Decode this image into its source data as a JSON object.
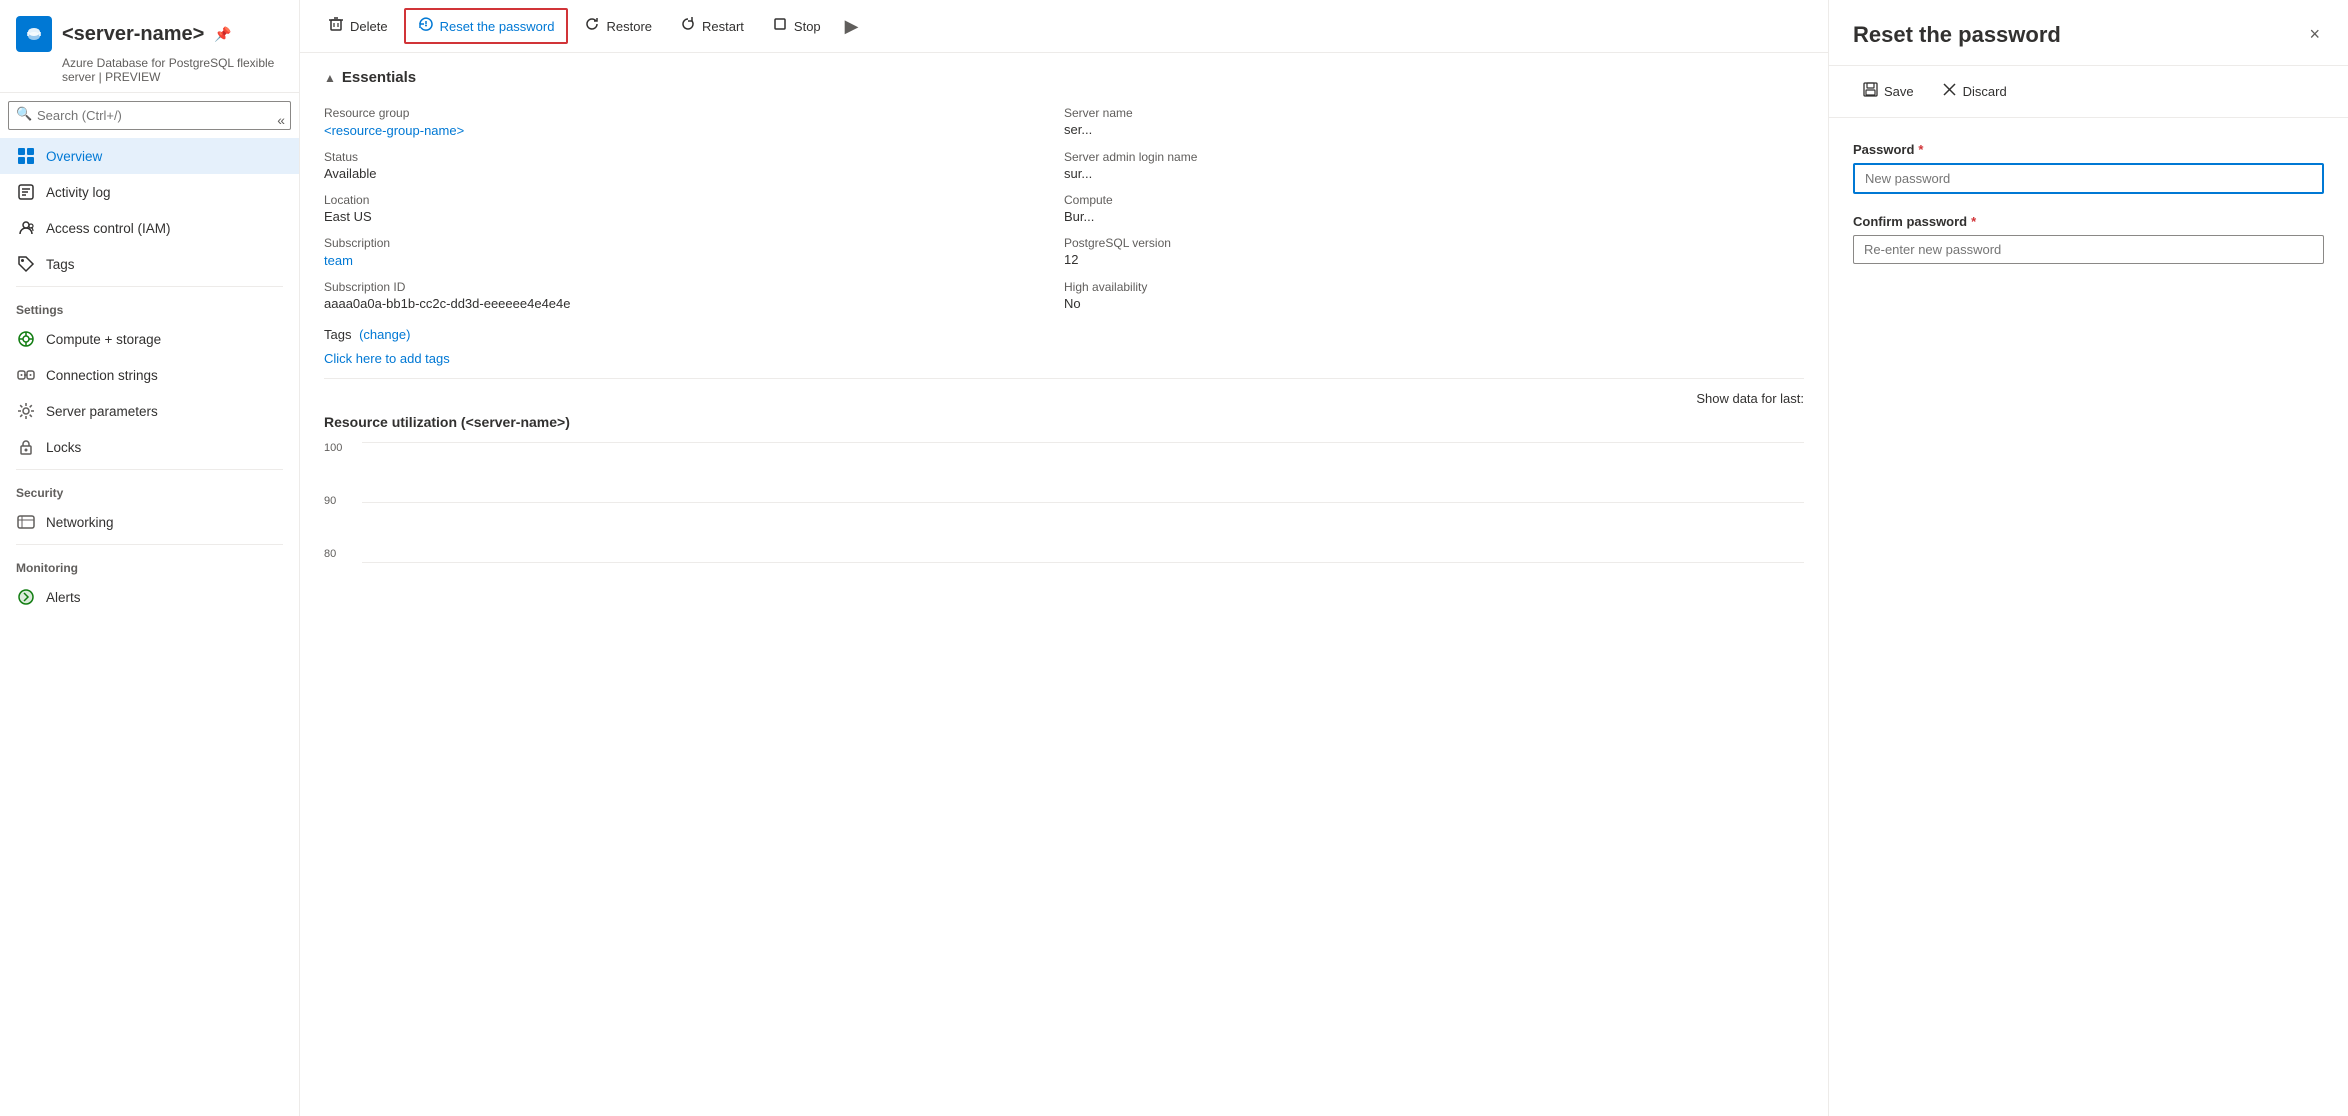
{
  "sidebar": {
    "server_name": "<server-name>",
    "server_subtitle": "Azure Database for PostgreSQL flexible server | PREVIEW",
    "search_placeholder": "Search (Ctrl+/)",
    "collapse_label": "«",
    "nav_items": [
      {
        "id": "overview",
        "label": "Overview",
        "icon": "🔵",
        "active": true
      },
      {
        "id": "activity-log",
        "label": "Activity log",
        "icon": "📋",
        "active": false
      },
      {
        "id": "access-control",
        "label": "Access control (IAM)",
        "icon": "👥",
        "active": false
      },
      {
        "id": "tags",
        "label": "Tags",
        "icon": "🏷",
        "active": false
      }
    ],
    "settings_section": "Settings",
    "settings_items": [
      {
        "id": "compute-storage",
        "label": "Compute + storage",
        "icon": "⚙"
      },
      {
        "id": "connection-strings",
        "label": "Connection strings",
        "icon": "🔗"
      },
      {
        "id": "server-parameters",
        "label": "Server parameters",
        "icon": "⚙"
      },
      {
        "id": "locks",
        "label": "Locks",
        "icon": "🔒"
      }
    ],
    "security_section": "Security",
    "security_items": [
      {
        "id": "networking",
        "label": "Networking",
        "icon": "🌐"
      }
    ],
    "monitoring_section": "Monitoring",
    "monitoring_items": [
      {
        "id": "alerts",
        "label": "Alerts",
        "icon": "🟢"
      }
    ]
  },
  "toolbar": {
    "delete_label": "Delete",
    "reset_password_label": "Reset the password",
    "restore_label": "Restore",
    "restart_label": "Restart",
    "stop_label": "Stop"
  },
  "essentials": {
    "header": "Essentials",
    "items": [
      {
        "label": "Resource group",
        "value": "<resource-group-name>",
        "is_link": true
      },
      {
        "label": "Server name",
        "value": "ser...",
        "is_link": false
      },
      {
        "label": "Status",
        "value": "Available",
        "is_link": false
      },
      {
        "label": "Server admin login name",
        "value": "sur...",
        "is_link": false
      },
      {
        "label": "Location",
        "value": "East US",
        "is_link": false
      },
      {
        "label": "Compute",
        "value": "Bur...",
        "is_link": false
      },
      {
        "label": "Subscription",
        "value": "team",
        "is_link": true
      },
      {
        "label": "PostgreSQL version",
        "value": "12",
        "is_link": false
      },
      {
        "label": "Subscription ID",
        "value": "aaaa0a0a-bb1b-cc2c-dd3d-eeeeee4e4e4e",
        "is_link": false
      },
      {
        "label": "High availability",
        "value": "No",
        "is_link": false
      }
    ]
  },
  "tags": {
    "label": "Tags",
    "change_link": "(change)",
    "add_link": "Click here to add tags"
  },
  "show_data": {
    "label": "Show data for last:"
  },
  "utilization": {
    "title": "Resource utilization (<server-name>)",
    "y_labels": [
      "100",
      "90",
      "80"
    ]
  },
  "reset_panel": {
    "title": "Reset the password",
    "close_label": "×",
    "save_label": "Save",
    "discard_label": "Discard",
    "password_label": "Password",
    "password_placeholder": "New password",
    "confirm_label": "Confirm password",
    "confirm_placeholder": "Re-enter new password",
    "required_marker": "*"
  }
}
